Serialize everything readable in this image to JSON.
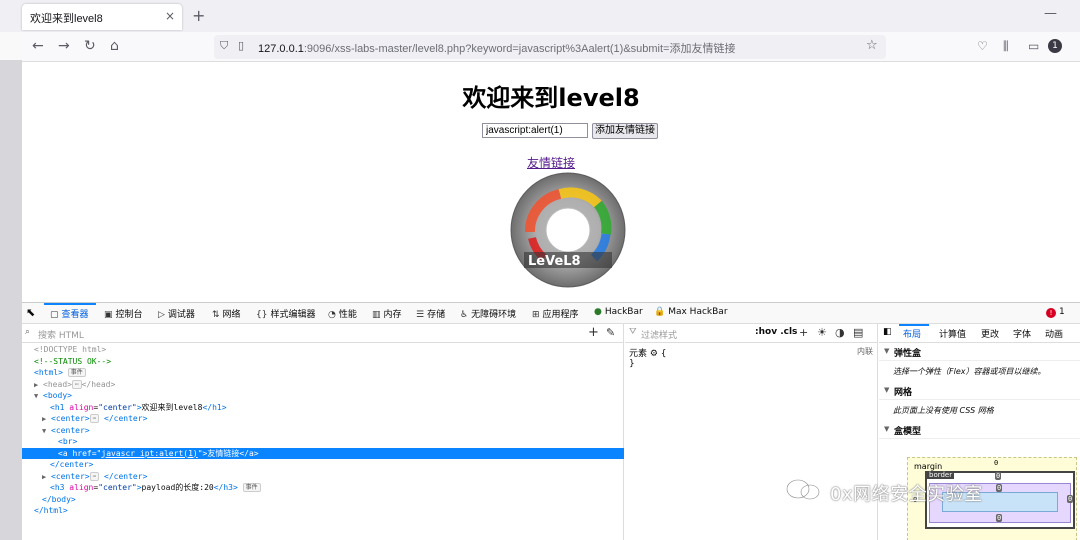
{
  "browser": {
    "tab_title": "欢迎来到level8",
    "tab_close": "×",
    "new_tab": "+",
    "url_host": "127.0.0.1",
    "url_rest": ":9096/xss-labs-master/level8.php?keyword=javascript%3Aalert(1)&submit=添加友情链接",
    "badge": "1"
  },
  "page": {
    "title": "欢迎来到level8",
    "keyword_value": "javascript:alert(1)",
    "submit_label": "添加友情链接",
    "friend_link": "友情链接",
    "image_label": "LeVeL8"
  },
  "devtools": {
    "tabs": [
      {
        "label": "查看器",
        "icon": "inspector-icon"
      },
      {
        "label": "控制台",
        "icon": "console-icon"
      },
      {
        "label": "调试器",
        "icon": "debugger-icon"
      },
      {
        "label": "网络",
        "icon": "network-icon"
      },
      {
        "label": "样式编辑器",
        "icon": "style-editor-icon"
      },
      {
        "label": "性能",
        "icon": "performance-icon"
      },
      {
        "label": "内存",
        "icon": "memory-icon"
      },
      {
        "label": "存储",
        "icon": "storage-icon"
      },
      {
        "label": "无障碍环境",
        "icon": "accessibility-icon"
      },
      {
        "label": "应用程序",
        "icon": "application-icon"
      },
      {
        "label": "HackBar",
        "icon": "hackbar-icon"
      },
      {
        "label": "Max HackBar",
        "icon": "max-hackbar-icon"
      }
    ],
    "error_count": "1",
    "search_placeholder": "搜索 HTML",
    "filter_placeholder": "过滤样式",
    "hov": ":hov",
    "cls": ".cls",
    "element_rule": "元素 ⚙ {",
    "element_close": "}",
    "inline_label": "内联",
    "layout_tabs": [
      "布局",
      "计算值",
      "更改",
      "字体",
      "动画"
    ],
    "flex_heading": "弹性盒",
    "flex_note": "选择一个弹性（Flex）容器或项目以继续。",
    "grid_heading": "网格",
    "grid_note": "此页面上没有使用 CSS 网格",
    "boxmodel_heading": "盒模型",
    "margin_label": "margin",
    "border_label": "border",
    "zero": "0"
  },
  "tree": {
    "r0": "<!DOCTYPE html>",
    "r1": "<!--STATUS OK-->",
    "h1_text": "欢迎来到level8",
    "href": "javascr_ipt:alert(1)",
    "link_text": "友情链接",
    "h3_text": "payload的长度:20",
    "event_pill": "事件",
    "ellipsis": "⋯",
    "center_ellipsis": "⋯"
  },
  "watermark": "0x网络安全实验室"
}
